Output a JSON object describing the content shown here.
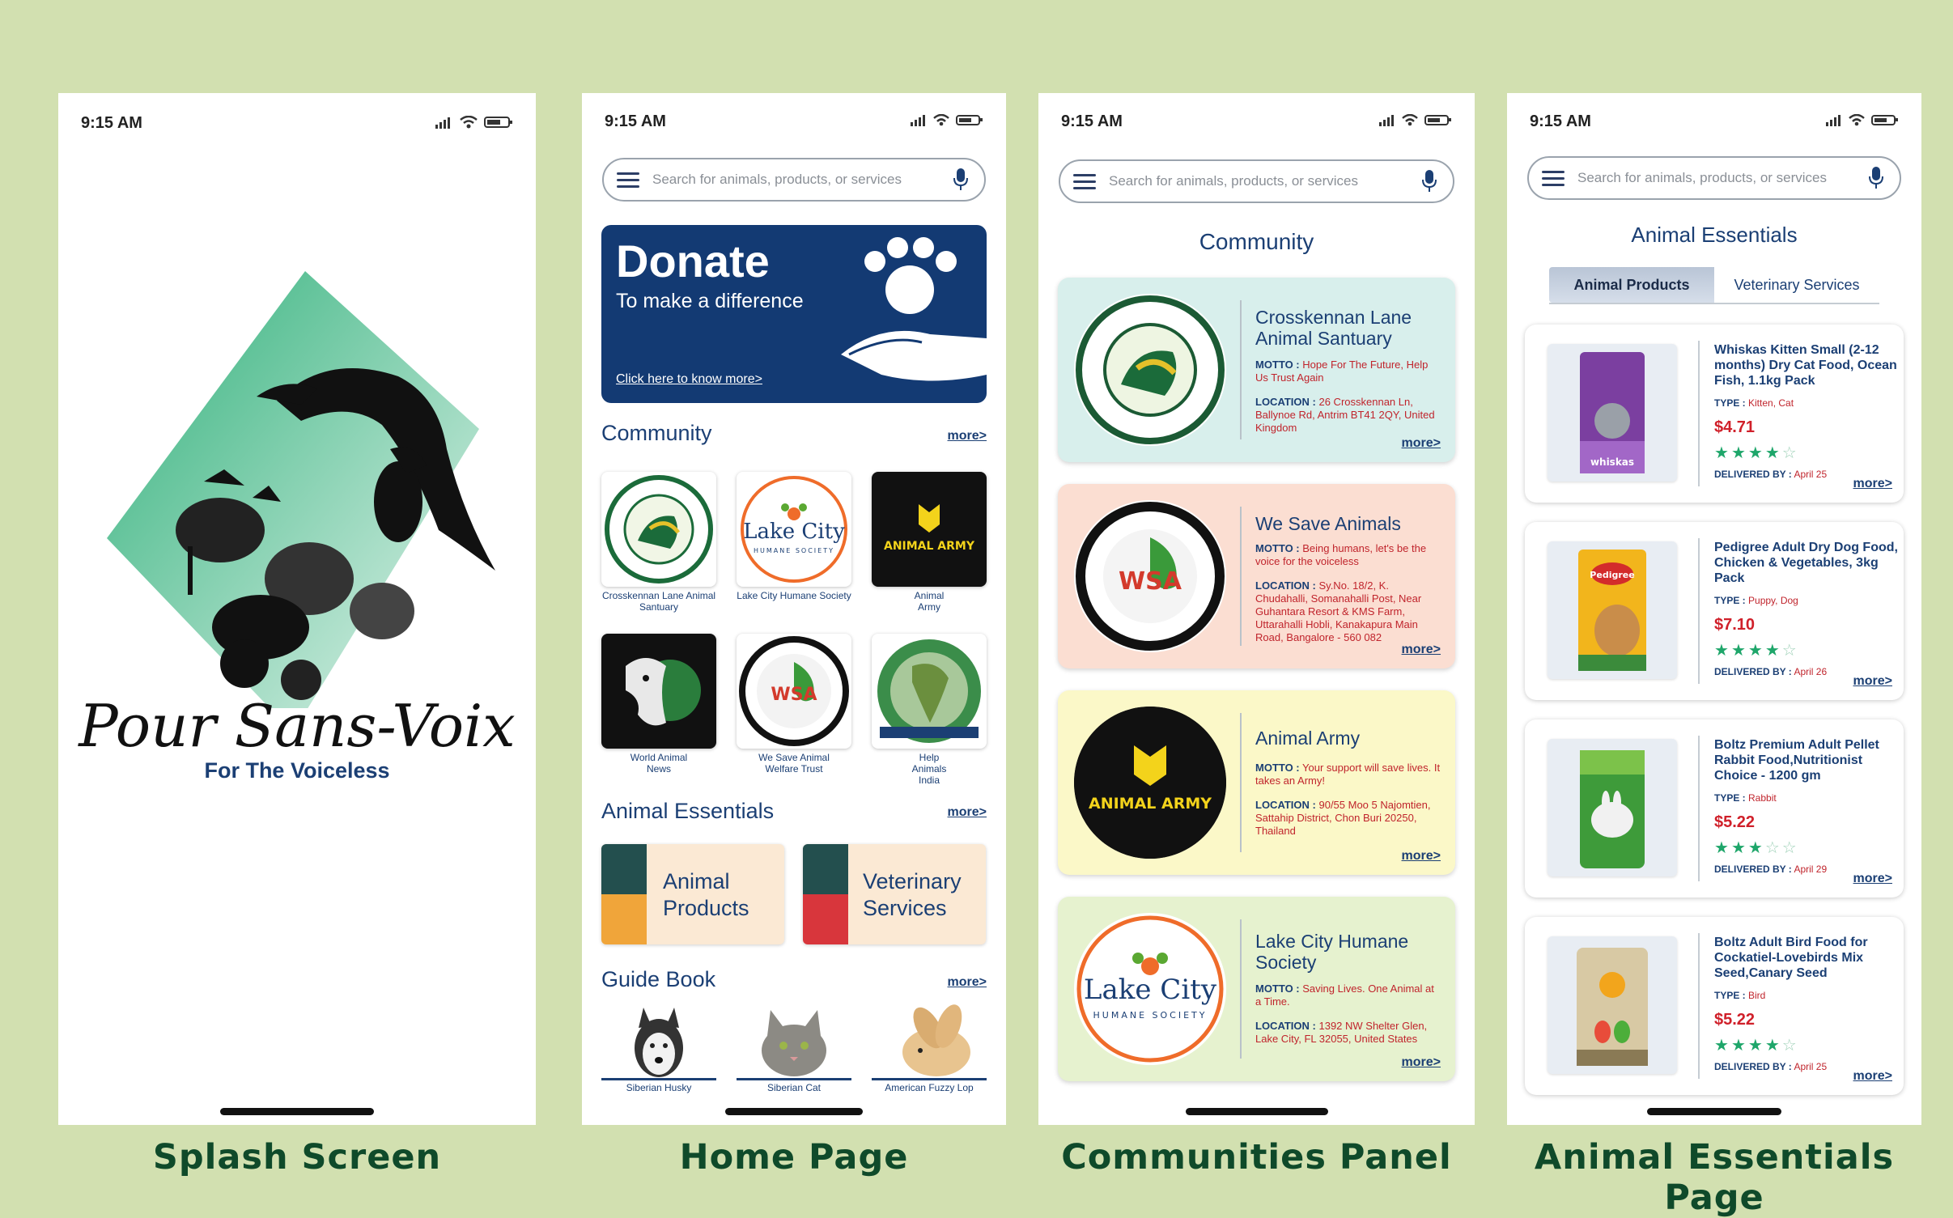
{
  "status_time": "9:15 AM",
  "search_placeholder": "Search for animals, products, or services",
  "captions": [
    "Splash Screen",
    "Home Page",
    "Communities Panel",
    "Animal Essentials Page"
  ],
  "splash": {
    "brand": "Pour Sans-Voix",
    "tagline": "For The Voiceless"
  },
  "home": {
    "donate": {
      "title": "Donate",
      "subtitle": "To make a difference",
      "link": "Click here to know more>"
    },
    "community": {
      "title": "Community",
      "more": "more>",
      "items": [
        {
          "label": "Crosskennan Lane Animal Santuary"
        },
        {
          "label": "Lake City Humane Society"
        },
        {
          "label": "Animal Army"
        },
        {
          "label": "World Animal News"
        },
        {
          "label": "We Save Animal Welfare Trust"
        },
        {
          "label": "Help Animals India"
        }
      ]
    },
    "essentials": {
      "title": "Animal Essentials",
      "more": "more>",
      "items": [
        {
          "label": "Animal Products"
        },
        {
          "label": "Veterinary Services"
        }
      ]
    },
    "guide": {
      "title": "Guide Book",
      "more": "more>",
      "items": [
        {
          "label": "Siberian Husky"
        },
        {
          "label": "Siberian Cat"
        },
        {
          "label": "American Fuzzy Lop"
        }
      ]
    }
  },
  "communities": {
    "title": "Community",
    "cards": [
      {
        "name": "Crosskennan Lane Animal Santuary",
        "motto_label": "MOTTO :",
        "motto": "Hope For The Future, Help Us Trust Again",
        "location_label": "LOCATION :",
        "location": "26 Crosskennan Ln, Ballynoe Rd, Antrim BT41 2QY, United Kingdom",
        "more": "more>",
        "bg": "#d8efec"
      },
      {
        "name": "We Save Animals",
        "motto_label": "MOTTO :",
        "motto": "Being humans, let's be the voice for the voiceless",
        "location_label": "LOCATION :",
        "location": "Sy.No. 18/2, K. Chudahalli, Somanahalli Post, Near Guhantara Resort & KMS Farm, Uttarahalli Hobli, Kanakapura Main Road, Bangalore - 560 082",
        "more": "more>",
        "bg": "#fbded2"
      },
      {
        "name": "Animal Army",
        "motto_label": "MOTTO :",
        "motto": "Your support will save lives. It takes an Army!",
        "location_label": "LOCATION :",
        "location": "90/55 Moo 5 Najomtien, Sattahip District, Chon Buri 20250, Thailand",
        "more": "more>",
        "bg": "#fbf8c8"
      },
      {
        "name": "Lake City Humane Society",
        "motto_label": "MOTTO :",
        "motto": "Saving Lives. One Animal at a Time.",
        "location_label": "LOCATION :",
        "location": "1392 NW Shelter Glen, Lake City, FL 32055, United States",
        "more": "more>",
        "bg": "#e6f2cf"
      }
    ]
  },
  "essentials_page": {
    "title": "Animal Essentials",
    "tabs": [
      {
        "label": "Animal Products",
        "active": true
      },
      {
        "label": "Veterinary Services",
        "active": false
      }
    ],
    "products": [
      {
        "name": "Whiskas Kitten Small (2-12 months) Dry Cat Food, Ocean Fish, 1.1kg Pack",
        "type_label": "TYPE :",
        "type": "Kitten, Cat",
        "price": "$4.71",
        "rating": 4,
        "delivered_label": "DELIVERED BY :",
        "delivered": "April 25",
        "more": "more>",
        "pack_color": "#7b3fa0"
      },
      {
        "name": "Pedigree Adult Dry Dog Food, Chicken & Vegetables, 3kg Pack",
        "type_label": "TYPE :",
        "type": "Puppy, Dog",
        "price": "$7.10",
        "rating": 4,
        "delivered_label": "DELIVERED BY :",
        "delivered": "April 26",
        "more": "more>",
        "pack_color": "#f2b51c"
      },
      {
        "name": "Boltz Premium Adult Pellet Rabbit Food,Nutritionist Choice - 1200 gm",
        "type_label": "TYPE :",
        "type": "Rabbit",
        "price": "$5.22",
        "rating": 3,
        "delivered_label": "DELIVERED BY :",
        "delivered": "April 29",
        "more": "more>",
        "pack_color": "#3e9b3a"
      },
      {
        "name": "Boltz Adult Bird Food for Cockatiel-Lovebirds Mix Seed,Canary Seed",
        "type_label": "TYPE :",
        "type": "Bird",
        "price": "$5.22",
        "rating": 4,
        "delivered_label": "DELIVERED BY :",
        "delivered": "April 25",
        "more": "more>",
        "pack_color": "#c9b48a"
      }
    ]
  },
  "colors": {
    "background": "#d2e0b0",
    "navy": "#1b3f74",
    "accent_red": "#c0242c",
    "star_green": "#1ea66a",
    "donate_bg": "#133a73"
  }
}
